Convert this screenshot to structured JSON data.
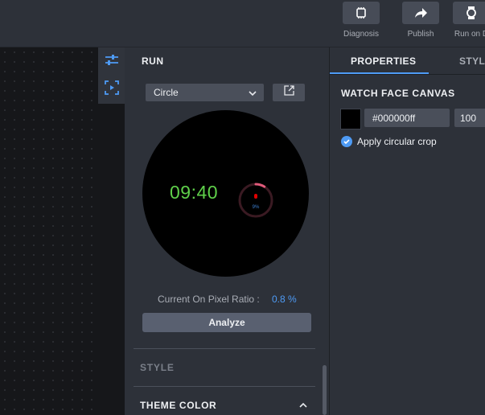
{
  "toolbar": {
    "buttons": [
      {
        "label": "Diagnosis",
        "icon": "diagnosis-icon"
      },
      {
        "label": "Publish",
        "icon": "publish-icon"
      },
      {
        "label": "Run on D",
        "icon": "run-on-device-icon"
      }
    ]
  },
  "left_tools": [
    {
      "icon": "sliders-icon",
      "active": true
    },
    {
      "icon": "screen-capture-icon",
      "active": false
    }
  ],
  "run_panel": {
    "title": "RUN",
    "shape_select": {
      "value": "Circle"
    },
    "preview": {
      "time": "09:40",
      "gauge_label": "9%",
      "gauge_progress": 0.09,
      "colors": {
        "time": "#5fd04a",
        "gauge_arc": "#e05a7a",
        "gauge_track": "#3a1a22",
        "gauge_dot": "#e00000",
        "gauge_text": "#3d7fd0"
      }
    },
    "ratio_label": "Current On Pixel Ratio :",
    "ratio_value": "0.8 %",
    "analyze_label": "Analyze",
    "sections": {
      "style": "STYLE",
      "theme_color": "THEME COLOR"
    }
  },
  "properties_panel": {
    "tabs": [
      "PROPERTIES",
      "STYL"
    ],
    "active_tab": "PROPERTIES",
    "section_title": "WATCH FACE CANVAS",
    "color_value": "#000000ff",
    "swatch_color": "#000000",
    "alpha_value": "100",
    "circular_crop": {
      "label": "Apply circular crop",
      "checked": true
    }
  },
  "colors": {
    "accent": "#4e9bf5",
    "background": "#2d3139"
  }
}
